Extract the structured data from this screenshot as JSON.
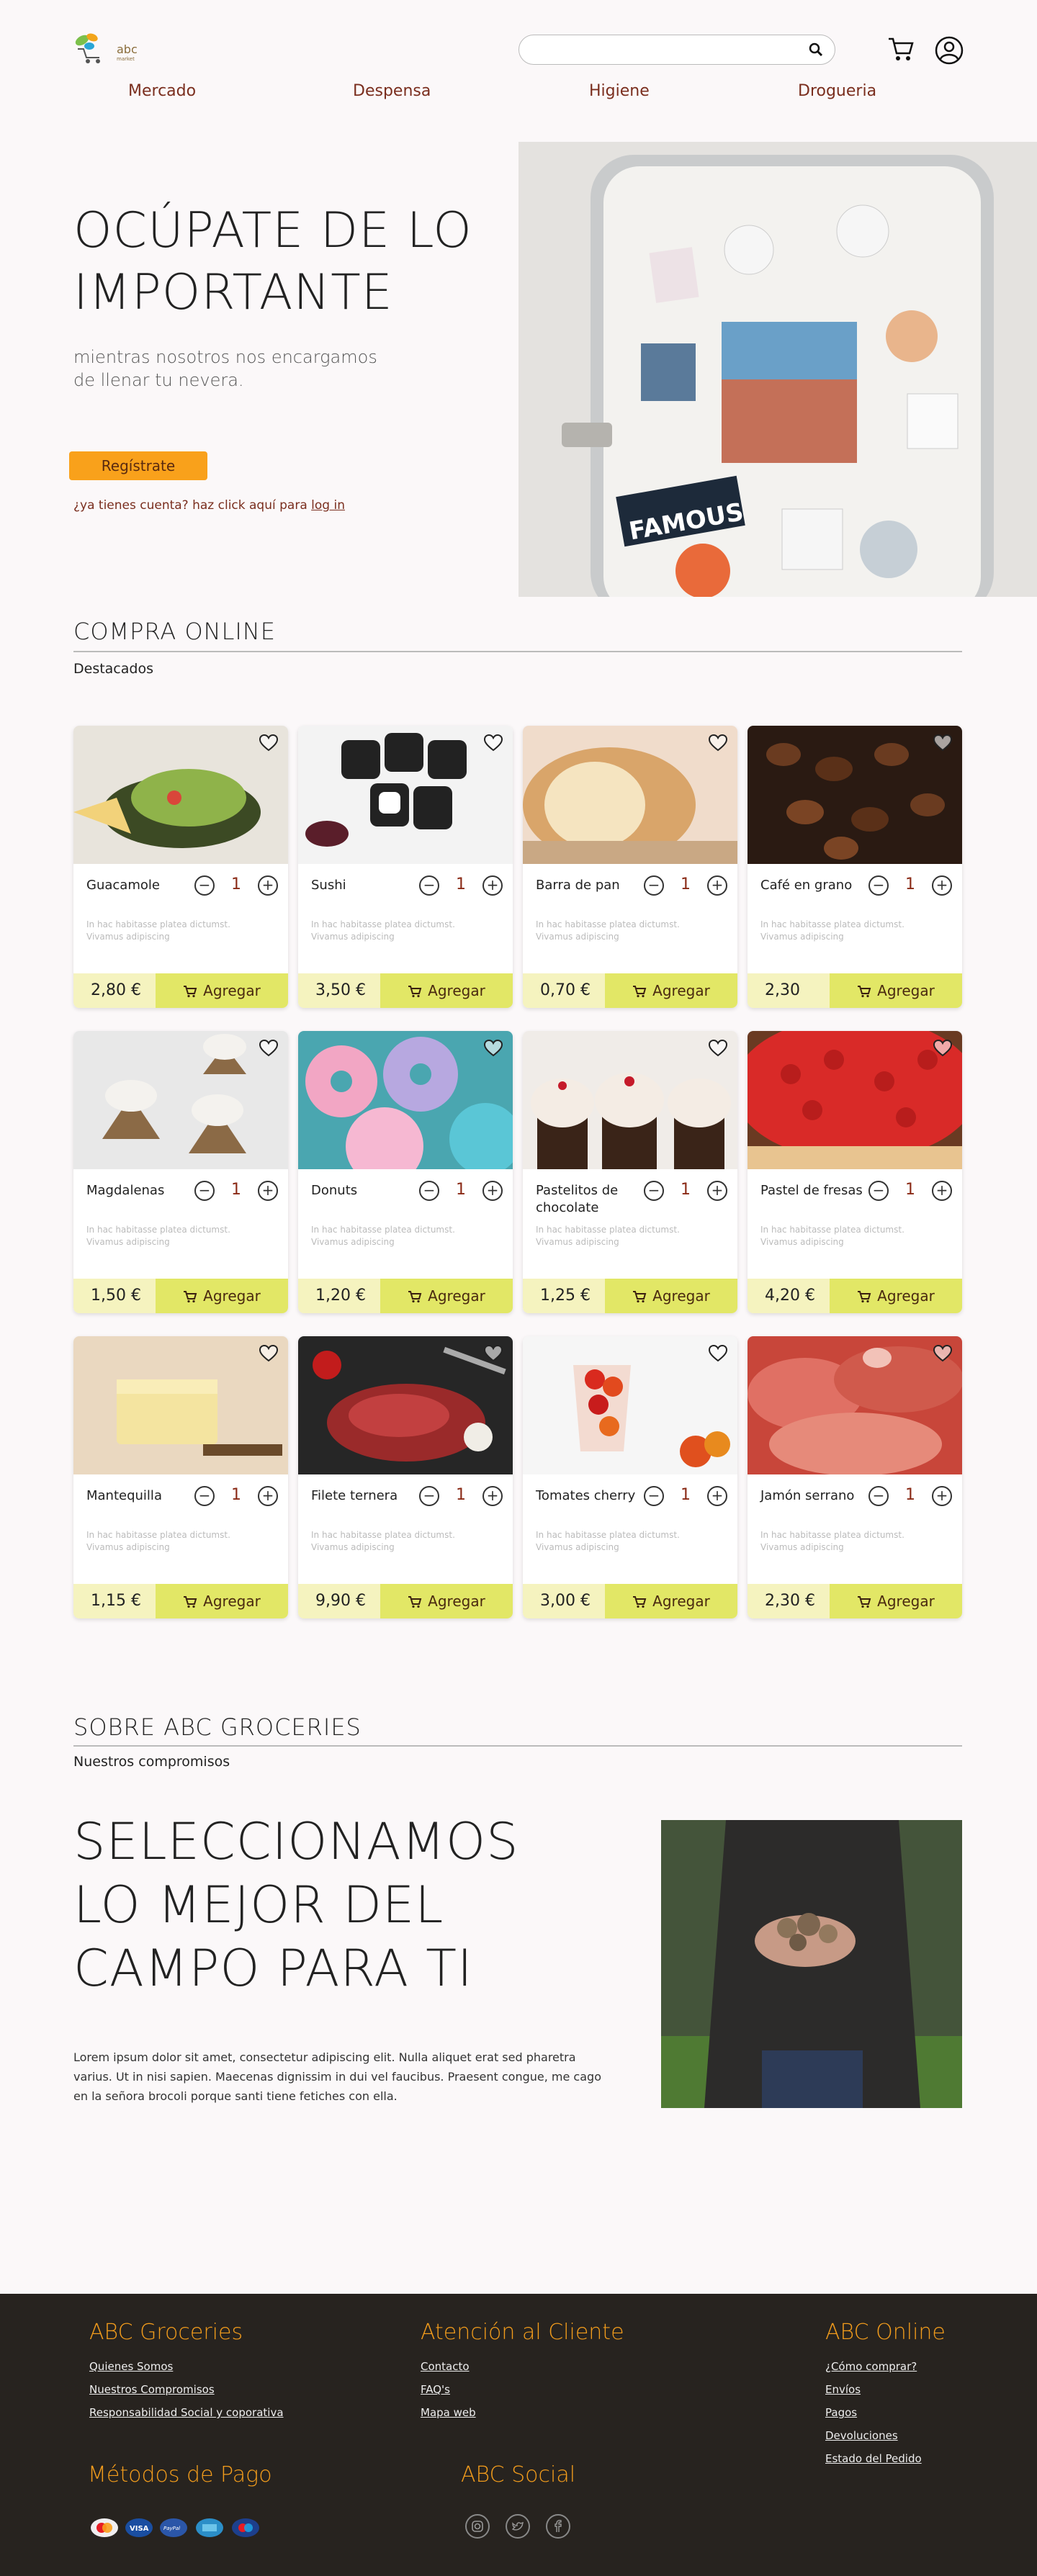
{
  "header": {
    "logo_text": "abc",
    "logo_sub": "market",
    "search_placeholder": "",
    "nav": [
      "Mercado",
      "Despensa",
      "Higiene",
      "Drogueria"
    ]
  },
  "hero": {
    "title": "OCÚPATE DE LO IMPORTANTE",
    "subtitle": "mientras nosotros nos encargamos de llenar tu nevera.",
    "register_label": "Regístrate",
    "login_prefix": "¿ya tienes cuenta? haz click aquí para ",
    "login_link": "log in"
  },
  "shop": {
    "title": "COMPRA ONLINE",
    "subtitle": "Destacados",
    "add_label": "Agregar",
    "desc": "In hac habitasse platea dictumst. Vivamus adipiscing",
    "products": [
      {
        "name": "Guacamole",
        "qty": "1",
        "price": "2,80 €"
      },
      {
        "name": "Sushi",
        "qty": "1",
        "price": "3,50 €"
      },
      {
        "name": "Barra de pan",
        "qty": "1",
        "price": "0,70 €"
      },
      {
        "name": "Café en grano",
        "qty": "1",
        "price": "2,30"
      },
      {
        "name": "Magdalenas",
        "qty": "1",
        "price": "1,50 €"
      },
      {
        "name": "Donuts",
        "qty": "1",
        "price": "1,20 €"
      },
      {
        "name": "Pastelitos de chocolate",
        "qty": "1",
        "price": "1,25 €"
      },
      {
        "name": "Pastel de fresas",
        "qty": "1",
        "price": "4,20 €"
      },
      {
        "name": "Mantequilla",
        "qty": "1",
        "price": "1,15 €"
      },
      {
        "name": "Filete ternera",
        "qty": "1",
        "price": "9,90 €"
      },
      {
        "name": "Tomates cherry",
        "qty": "1",
        "price": "3,00 €"
      },
      {
        "name": "Jamón serrano",
        "qty": "1",
        "price": "2,30 €"
      }
    ]
  },
  "about": {
    "title": "SOBRE ABC GROCERIES",
    "subtitle": "Nuestros compromisos",
    "headline": "SELECCIONAMOS LO MEJOR DEL CAMPO PARA TI",
    "text": "Lorem ipsum dolor sit amet, consectetur adipiscing elit. Nulla aliquet erat sed pharetra varius. Ut in nisi sapien. Maecenas dignissim in dui vel faucibus. Praesent congue, me cago en la señora brocoli porque santi tiene fetiches con ella."
  },
  "footer": {
    "col1": {
      "title": "ABC Groceries",
      "links": [
        "Quienes Somos",
        "Nuestros Compromisos",
        "Responsabilidad Social y coporativa"
      ]
    },
    "col2": {
      "title": "Atención al Cliente",
      "links": [
        "Contacto",
        "FAQ's",
        "Mapa web"
      ]
    },
    "col3": {
      "title": "ABC Online",
      "links": [
        "¿Cómo comprar?",
        "Envíos",
        "Pagos",
        "Devoluciones",
        "Estado del Pedido"
      ]
    },
    "pay_title": "Métodos de Pago",
    "social_title": "ABC Social",
    "pay_methods": [
      "mastercard",
      "VISA",
      "PayPal",
      "AMEX",
      "maestro"
    ]
  },
  "colors": {
    "accent_orange": "#f9a11b",
    "footer_heading": "#f29c1c",
    "nav_text": "#7a2e1e",
    "add_button": "#e2e766",
    "price_bg": "#f5f3bf",
    "footer_bg": "#27231f"
  }
}
